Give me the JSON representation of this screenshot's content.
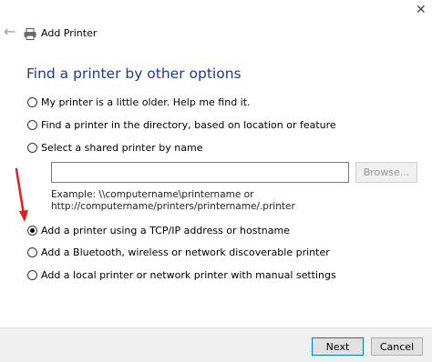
{
  "window": {
    "title": "Add Printer",
    "back_glyph": "←",
    "close_glyph": "✕",
    "icons": [
      "back-arrow-icon",
      "printer-icon",
      "close-icon"
    ]
  },
  "heading": "Find a printer by other options",
  "options": [
    {
      "label": "My printer is a little older. Help me find it.",
      "selected": false
    },
    {
      "label": "Find a printer in the directory, based on location or feature",
      "selected": false
    },
    {
      "label": "Select a shared printer by name",
      "selected": false
    },
    {
      "label": "Add a printer using a TCP/IP address or hostname",
      "selected": true
    },
    {
      "label": "Add a Bluetooth, wireless or network discoverable printer",
      "selected": false
    },
    {
      "label": "Add a local printer or network printer with manual settings",
      "selected": false
    }
  ],
  "shared_printer": {
    "value": "",
    "browse_label": "Browse...",
    "example_line1": "Example: \\\\computername\\printername or",
    "example_line2": "http://computername/printers/printername/.printer"
  },
  "buttons": {
    "next_label": "Next",
    "cancel_label": "Cancel"
  },
  "colors": {
    "heading": "#1e3a8a",
    "annotation_arrow": "#e02020",
    "focus_border": "#0078d7"
  }
}
